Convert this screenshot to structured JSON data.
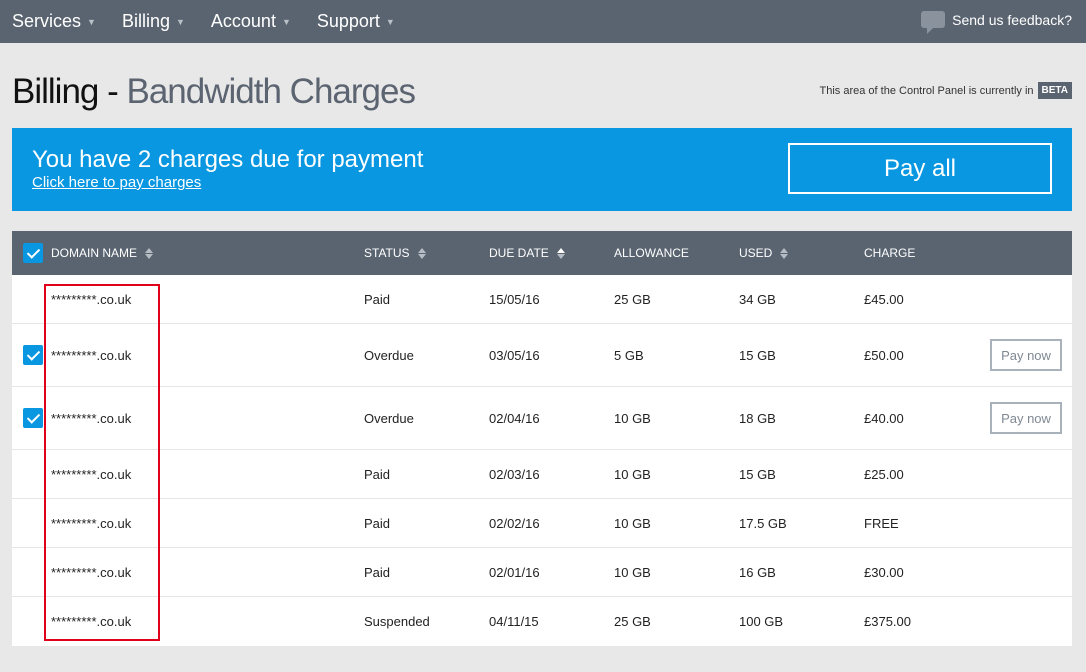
{
  "nav": {
    "items": [
      {
        "label": "Services"
      },
      {
        "label": "Billing"
      },
      {
        "label": "Account"
      },
      {
        "label": "Support"
      }
    ],
    "feedback_label": "Send us feedback?"
  },
  "header": {
    "title_section": "Billing -",
    "title_page": "Bandwidth Charges",
    "beta_note": "This area of the Control Panel is currently in",
    "beta_badge": "BETA"
  },
  "banner": {
    "message": "You have 2 charges due for payment",
    "link": "Click here to pay charges",
    "pay_all_label": "Pay all",
    "color": "#0897e0"
  },
  "table": {
    "columns": [
      {
        "label": "DOMAIN NAME",
        "sortable": true
      },
      {
        "label": "STATUS",
        "sortable": true
      },
      {
        "label": "DUE DATE",
        "sortable": true
      },
      {
        "label": "ALLOWANCE",
        "sortable": false
      },
      {
        "label": "USED",
        "sortable": true
      },
      {
        "label": "CHARGE",
        "sortable": false
      }
    ],
    "rows": [
      {
        "domain": "*********.co.uk",
        "status": "Paid",
        "due": "15/05/16",
        "allowance": "25 GB",
        "used": "34 GB",
        "charge": "£45.00",
        "checked": false,
        "action": ""
      },
      {
        "domain": "*********.co.uk",
        "status": "Overdue",
        "due": "03/05/16",
        "allowance": "5 GB",
        "used": "15 GB",
        "charge": "£50.00",
        "checked": true,
        "action": "Pay now"
      },
      {
        "domain": "*********.co.uk",
        "status": "Overdue",
        "due": "02/04/16",
        "allowance": "10 GB",
        "used": "18 GB",
        "charge": "£40.00",
        "checked": true,
        "action": "Pay now"
      },
      {
        "domain": "*********.co.uk",
        "status": "Paid",
        "due": "02/03/16",
        "allowance": "10 GB",
        "used": "15 GB",
        "charge": "£25.00",
        "checked": false,
        "action": ""
      },
      {
        "domain": "*********.co.uk",
        "status": "Paid",
        "due": "02/02/16",
        "allowance": "10 GB",
        "used": "17.5 GB",
        "charge": "FREE",
        "checked": false,
        "action": ""
      },
      {
        "domain": "*********.co.uk",
        "status": "Paid",
        "due": "02/01/16",
        "allowance": "10 GB",
        "used": "16 GB",
        "charge": "£30.00",
        "checked": false,
        "action": ""
      },
      {
        "domain": "*********.co.uk",
        "status": "Suspended",
        "due": "04/11/15",
        "allowance": "25 GB",
        "used": "100 GB",
        "charge": "£375.00",
        "checked": false,
        "action": ""
      }
    ]
  },
  "colors": {
    "nav_bg": "#5a6470",
    "accent": "#0897e0",
    "highlight": "#e0001a"
  }
}
